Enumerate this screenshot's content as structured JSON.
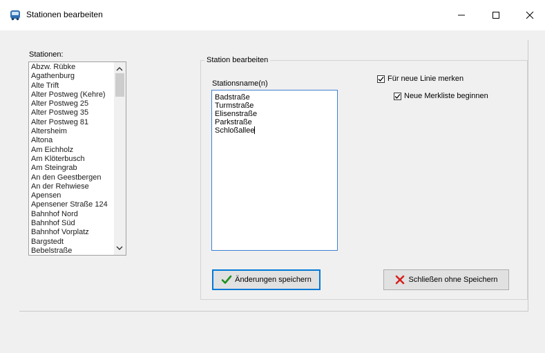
{
  "window": {
    "title": "Stationen bearbeiten",
    "minimize_symbol": "—",
    "maximize_symbol": "☐",
    "close_symbol": "✕"
  },
  "stations": {
    "label": "Stationen:",
    "items": [
      "Abzw. Rübke",
      "Agathenburg",
      "Alte Trift",
      "Alter Postweg (Kehre)",
      "Alter Postweg 25",
      "Alter Postweg 35",
      "Alter Postweg 81",
      "Altersheim",
      "Altona",
      "Am Eichholz",
      "Am Klöterbusch",
      "Am Steingrab",
      "An den Geestbergen",
      "An der Rehwiese",
      "Apensen",
      "Apensener Straße 124",
      "Bahnhof Nord",
      "Bahnhof Süd",
      "Bahnhof Vorplatz",
      "Bargstedt",
      "Bebelstraße"
    ]
  },
  "edit_group": {
    "title": "Station bearbeiten",
    "names_label": "Stationsname(n)",
    "names": [
      "Badstraße",
      "Turmstraße",
      "Elisenstraße",
      "Parkstraße",
      "Schloßallee"
    ]
  },
  "options": {
    "remember_new_line": {
      "label": "Für neue Linie merken",
      "checked": true
    },
    "new_memo_list": {
      "label": "Neue Merkliste beginnen",
      "checked": true
    }
  },
  "buttons": {
    "save": {
      "label": "Änderungen speichern",
      "accent": "#1e8f1e"
    },
    "close_without_save": {
      "label": "Schließen ohne Speichern",
      "accent": "#d62020"
    }
  },
  "colors": {
    "focus_border": "#3c7fd4",
    "app_icon": "#2f6fb3"
  }
}
